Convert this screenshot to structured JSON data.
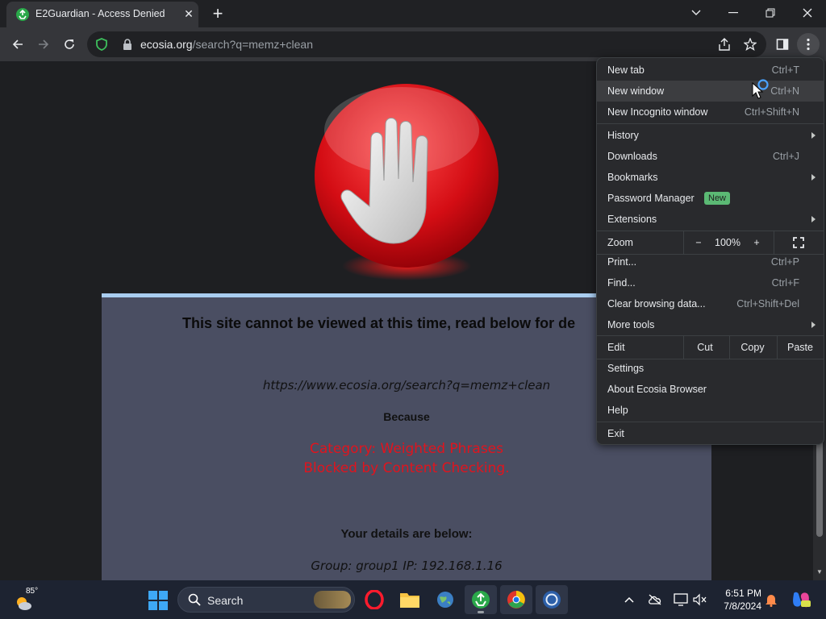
{
  "tab": {
    "title": "E2Guardian - Access Denied",
    "close_glyph": "✕",
    "new_tab_glyph": "+"
  },
  "window_controls": {
    "dropdown_glyph": "⌄",
    "minimize_glyph": "—",
    "restore_glyph": "❐",
    "close_glyph": "✕"
  },
  "address_bar": {
    "domain": "ecosia.org",
    "path": "/search?q=memz+clean"
  },
  "page": {
    "headline": "This site cannot be viewed at this time, read below for de",
    "blocked_url": "https://www.ecosia.org/search?q=memz+clean",
    "because": "Because",
    "category": "Category: Weighted Phrases",
    "reason": "Blocked by Content Checking.",
    "details_heading": "Your details are below:",
    "details": "Group: group1   IP: 192.168.1.16"
  },
  "menu": {
    "new_tab": {
      "label": "New tab",
      "shortcut": "Ctrl+T"
    },
    "new_window": {
      "label": "New window",
      "shortcut": "Ctrl+N"
    },
    "new_incognito": {
      "label": "New Incognito window",
      "shortcut": "Ctrl+Shift+N"
    },
    "history": {
      "label": "History"
    },
    "downloads": {
      "label": "Downloads",
      "shortcut": "Ctrl+J"
    },
    "bookmarks": {
      "label": "Bookmarks"
    },
    "password_manager": {
      "label": "Password Manager",
      "badge": "New"
    },
    "extensions": {
      "label": "Extensions"
    },
    "zoom": {
      "label": "Zoom",
      "minus": "−",
      "level": "100%",
      "plus": "+"
    },
    "print": {
      "label": "Print...",
      "shortcut": "Ctrl+P"
    },
    "find": {
      "label": "Find...",
      "shortcut": "Ctrl+F"
    },
    "clear_data": {
      "label": "Clear browsing data...",
      "shortcut": "Ctrl+Shift+Del"
    },
    "more_tools": {
      "label": "More tools"
    },
    "edit": {
      "label": "Edit",
      "cut": "Cut",
      "copy": "Copy",
      "paste": "Paste"
    },
    "settings": {
      "label": "Settings"
    },
    "about": {
      "label": "About Ecosia Browser"
    },
    "help": {
      "label": "Help"
    },
    "exit": {
      "label": "Exit"
    }
  },
  "taskbar": {
    "temperature": "85°",
    "search_label": "Search",
    "time": "6:51 PM",
    "date": "7/8/2024"
  },
  "colors": {
    "blocked_text": "#e0141e",
    "panel_bg": "#4a4e62",
    "panel_border": "#a9cdf0",
    "menu_bg": "#292a2d",
    "badge_bg": "#5bb974"
  }
}
